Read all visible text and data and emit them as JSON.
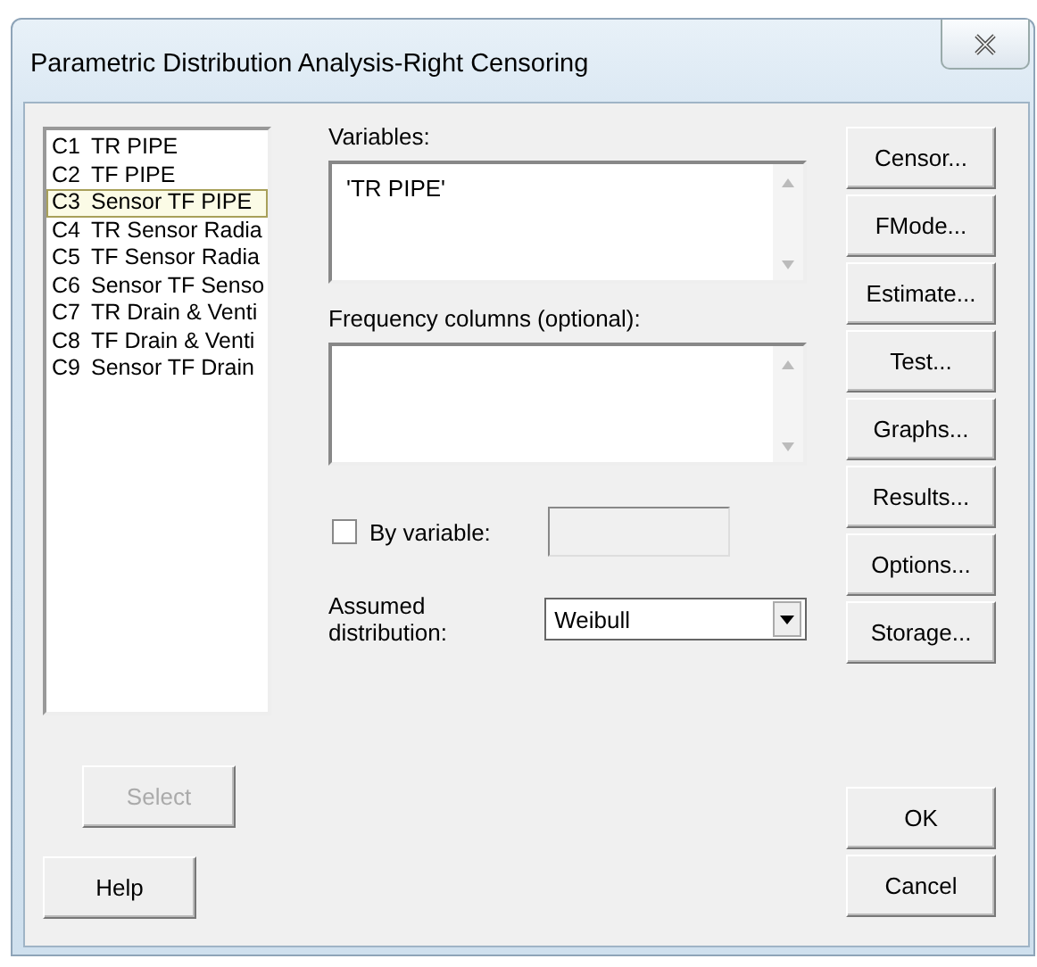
{
  "window": {
    "title": "Parametric Distribution Analysis-Right Censoring"
  },
  "columns": [
    {
      "code": "C1",
      "name": "TR PIPE",
      "selected": false
    },
    {
      "code": "C2",
      "name": "TF PIPE",
      "selected": false
    },
    {
      "code": "C3",
      "name": "Sensor TF PIPE",
      "selected": true
    },
    {
      "code": "C4",
      "name": "TR Sensor Radia",
      "selected": false
    },
    {
      "code": "C5",
      "name": "TF Sensor Radia",
      "selected": false
    },
    {
      "code": "C6",
      "name": "Sensor TF Senso",
      "selected": false
    },
    {
      "code": "C7",
      "name": "TR Drain & Venti",
      "selected": false
    },
    {
      "code": "C8",
      "name": "TF Drain & Venti",
      "selected": false
    },
    {
      "code": "C9",
      "name": "Sensor TF Drain",
      "selected": false
    }
  ],
  "variables": {
    "label": "Variables:",
    "value": "'TR PIPE'"
  },
  "frequency": {
    "label": "Frequency columns (optional):"
  },
  "by_variable": {
    "label": "By variable:",
    "checked": false
  },
  "distribution": {
    "label": "Assumed distribution:",
    "value": "Weibull"
  },
  "side_buttons": [
    "Censor...",
    "FMode...",
    "Estimate...",
    "Test...",
    "Graphs...",
    "Results...",
    "Options...",
    "Storage..."
  ],
  "select_button": {
    "label": "Select",
    "disabled": true
  },
  "help_button": "Help",
  "ok_button": "OK",
  "cancel_button": "Cancel"
}
